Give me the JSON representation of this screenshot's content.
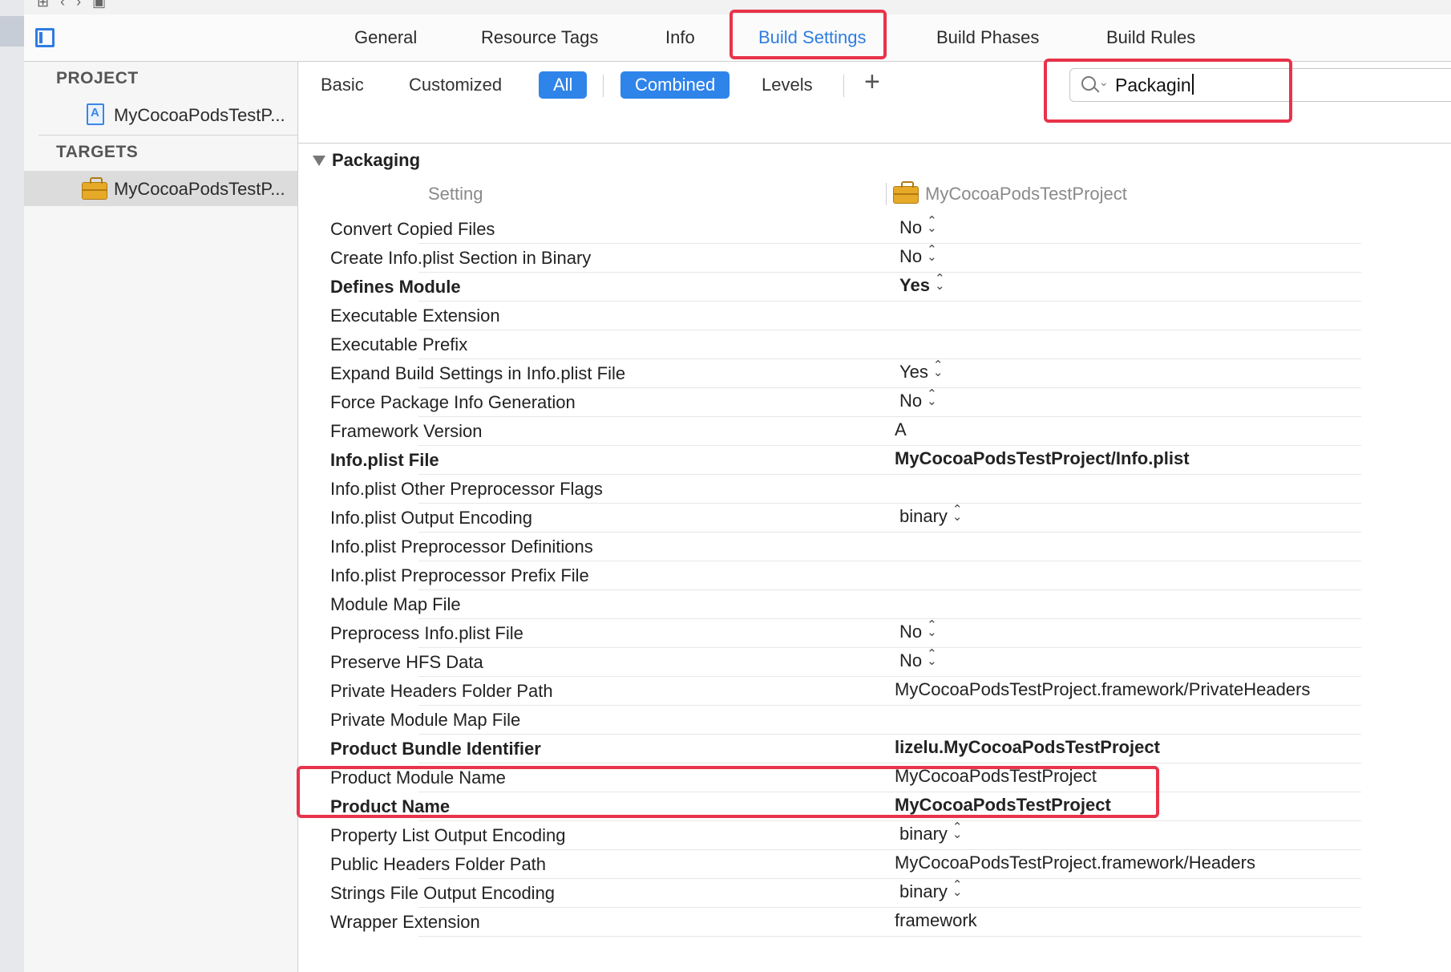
{
  "tabs": [
    {
      "label": "General",
      "active": false
    },
    {
      "label": "Resource Tags",
      "active": false
    },
    {
      "label": "Info",
      "active": false
    },
    {
      "label": "Build Settings",
      "active": true
    },
    {
      "label": "Build Phases",
      "active": false
    },
    {
      "label": "Build Rules",
      "active": false
    }
  ],
  "sidebar": {
    "project_header": "PROJECT",
    "project_item": "MyCocoaPodsTestP...",
    "targets_header": "TARGETS",
    "target_item": "MyCocoaPodsTestP..."
  },
  "filters": {
    "basic": "Basic",
    "customized": "Customized",
    "all": "All",
    "combined": "Combined",
    "levels": "Levels",
    "add": "+"
  },
  "search": {
    "value": "Packagin"
  },
  "section": {
    "title": "Packaging",
    "setting_header": "Setting",
    "target_header": "MyCocoaPodsTestProject"
  },
  "rows": [
    {
      "key": "Convert Copied Files",
      "value": "No",
      "popup": true,
      "bold": false
    },
    {
      "key": "Create Info.plist Section in Binary",
      "value": "No",
      "popup": true,
      "bold": false
    },
    {
      "key": "Defines Module",
      "value": "Yes",
      "popup": true,
      "bold": true
    },
    {
      "key": "Executable Extension",
      "value": "",
      "popup": false,
      "bold": false
    },
    {
      "key": "Executable Prefix",
      "value": "",
      "popup": false,
      "bold": false
    },
    {
      "key": "Expand Build Settings in Info.plist File",
      "value": "Yes",
      "popup": true,
      "bold": false
    },
    {
      "key": "Force Package Info Generation",
      "value": "No",
      "popup": true,
      "bold": false
    },
    {
      "key": "Framework Version",
      "value": "A",
      "popup": false,
      "bold": false
    },
    {
      "key": "Info.plist File",
      "value": "MyCocoaPodsTestProject/Info.plist",
      "popup": false,
      "bold": true
    },
    {
      "key": "Info.plist Other Preprocessor Flags",
      "value": "",
      "popup": false,
      "bold": false
    },
    {
      "key": "Info.plist Output Encoding",
      "value": "binary",
      "popup": true,
      "bold": false
    },
    {
      "key": "Info.plist Preprocessor Definitions",
      "value": "",
      "popup": false,
      "bold": false
    },
    {
      "key": "Info.plist Preprocessor Prefix File",
      "value": "",
      "popup": false,
      "bold": false
    },
    {
      "key": "Module Map File",
      "value": "",
      "popup": false,
      "bold": false
    },
    {
      "key": "Preprocess Info.plist File",
      "value": "No",
      "popup": true,
      "bold": false
    },
    {
      "key": "Preserve HFS Data",
      "value": "No",
      "popup": true,
      "bold": false
    },
    {
      "key": "Private Headers Folder Path",
      "value": "MyCocoaPodsTestProject.framework/PrivateHeaders",
      "popup": false,
      "bold": false
    },
    {
      "key": "Private Module Map File",
      "value": "",
      "popup": false,
      "bold": false
    },
    {
      "key": "Product Bundle Identifier",
      "value": "lizelu.MyCocoaPodsTestProject",
      "popup": false,
      "bold": true
    },
    {
      "key": "Product Module Name",
      "value": "MyCocoaPodsTestProject",
      "popup": false,
      "bold": false
    },
    {
      "key": "Product Name",
      "value": "MyCocoaPodsTestProject",
      "popup": false,
      "bold": true
    },
    {
      "key": "Property List Output Encoding",
      "value": "binary",
      "popup": true,
      "bold": false
    },
    {
      "key": "Public Headers Folder Path",
      "value": "MyCocoaPodsTestProject.framework/Headers",
      "popup": false,
      "bold": false
    },
    {
      "key": "Strings File Output Encoding",
      "value": "binary",
      "popup": true,
      "bold": false
    },
    {
      "key": "Wrapper Extension",
      "value": "framework",
      "popup": false,
      "bold": false
    }
  ],
  "colors": {
    "accent": "#2f84ea",
    "annotation": "#e8334a"
  }
}
